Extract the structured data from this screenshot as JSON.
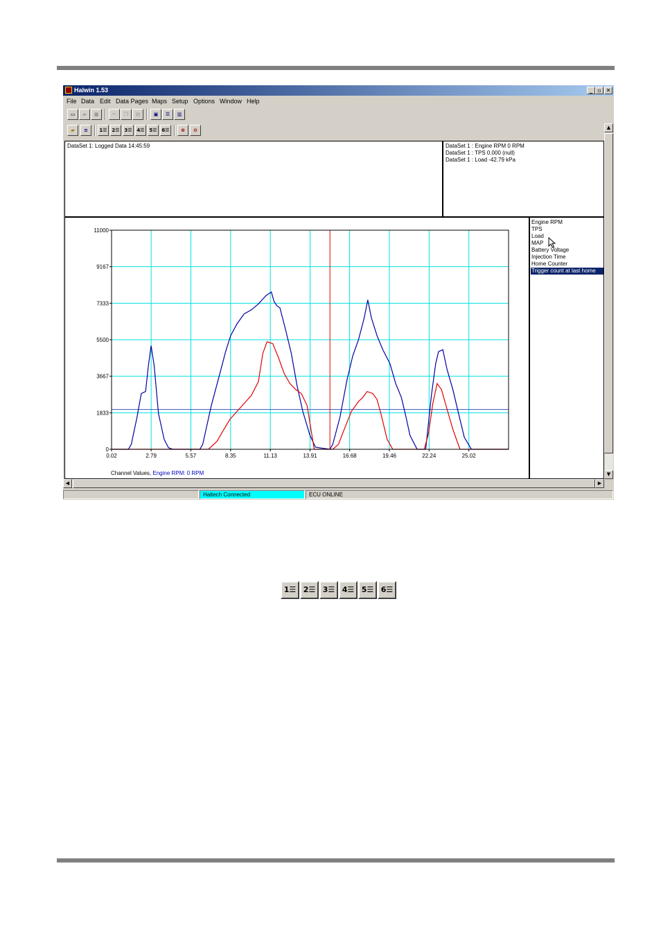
{
  "window": {
    "title": "Halwin 1.53",
    "controls": {
      "minimize": "_",
      "restore": "▫",
      "close": "✕"
    }
  },
  "menu": [
    "File",
    "Data",
    "Edit",
    "Data Pages",
    "Maps",
    "Setup",
    "Options",
    "Window",
    "Help"
  ],
  "info_left": {
    "line1": "DataSet 1: Logged Data 14:45:59"
  },
  "info_right": {
    "lines": [
      "DataSet 1 : Engine RPM 0 RPM",
      "DataSet 1 : TPS 0.000 (null)",
      "DataSet 1 : Load -42.79 kPa"
    ]
  },
  "channels": [
    "Engine RPM",
    "TPS",
    "Load",
    "MAP",
    "Battery Voltage",
    "Injection Time",
    "Home Counter",
    "Trigger count at last home"
  ],
  "selected_channel": 7,
  "channel_values": {
    "label": "Channel Values,",
    "value": "Engine RPM: 0 RPM"
  },
  "status": {
    "panel1": "",
    "panel2": "Haltech Connected",
    "panel3": "ECU ONLINE"
  },
  "toolbar2_numbers": [
    "1",
    "2",
    "3",
    "4",
    "5",
    "6"
  ],
  "zoom_buttons": [
    "1",
    "2",
    "3",
    "4",
    "5",
    "6"
  ],
  "colors": {
    "grid": "#00e0e0",
    "series_blue": "#0000a0",
    "series_red": "#e00000",
    "cursor": "#e00000",
    "connected_bg": "#00ffff"
  },
  "chart_data": {
    "type": "line",
    "xlim": [
      0.02,
      27.8
    ],
    "ylim": [
      0,
      11000
    ],
    "xticks": [
      "0.02",
      "2.79",
      "5.57",
      "8.35",
      "11.13",
      "13.91",
      "16.68",
      "19.46",
      "22.24",
      "25.02"
    ],
    "yticks": [
      "0",
      "1833",
      "3667",
      "5500",
      "7333",
      "9167",
      "11000"
    ],
    "cursor_x": 15.3,
    "hline_y": 2000,
    "series": [
      {
        "color": "#0000a0",
        "x": [
          0.02,
          1.2,
          1.4,
          1.8,
          2.1,
          2.4,
          2.6,
          2.79,
          3.0,
          3.3,
          3.7,
          4.0,
          4.3,
          4.5,
          6.2,
          6.4,
          7.0,
          7.6,
          8.0,
          8.35,
          8.8,
          9.3,
          9.8,
          10.3,
          10.8,
          11.2,
          11.4,
          11.6,
          11.8,
          12.2,
          12.6,
          13.0,
          13.4,
          13.9,
          14.3,
          15.3,
          15.5,
          16.0,
          16.5,
          16.9,
          17.3,
          17.7,
          17.95,
          18.2,
          18.6,
          19.0,
          19.5,
          19.9,
          20.3,
          20.6,
          20.9,
          21.4,
          21.7,
          22.0,
          22.4,
          22.7,
          22.9,
          23.2,
          23.5,
          23.9,
          24.3,
          24.7,
          25.2,
          27.8
        ],
        "y": [
          0,
          0,
          250,
          1600,
          2800,
          2900,
          4200,
          5200,
          4200,
          1800,
          500,
          80,
          0,
          0,
          0,
          250,
          2200,
          3800,
          4900,
          5700,
          6300,
          6800,
          7000,
          7300,
          7700,
          7900,
          7400,
          7200,
          7100,
          6000,
          4800,
          3200,
          1900,
          700,
          100,
          0,
          250,
          1600,
          3500,
          4700,
          5500,
          6600,
          7500,
          6600,
          5700,
          5000,
          4300,
          3300,
          2600,
          1700,
          700,
          0,
          0,
          0,
          2700,
          4300,
          4900,
          5000,
          4000,
          3000,
          1800,
          600,
          0,
          0
        ]
      },
      {
        "color": "#e00000",
        "x": [
          0.02,
          6.8,
          7.4,
          7.8,
          8.3,
          8.8,
          9.3,
          9.8,
          10.3,
          10.6,
          10.9,
          11.3,
          11.7,
          12.1,
          12.5,
          12.9,
          13.3,
          13.7,
          14.2,
          15.5,
          15.9,
          16.3,
          16.8,
          17.3,
          17.6,
          17.9,
          18.3,
          18.6,
          18.9,
          19.3,
          19.7,
          20.1,
          21.9,
          22.2,
          22.5,
          22.8,
          23.1,
          23.5,
          23.9,
          24.4,
          24.7,
          27.8
        ],
        "y": [
          0,
          0,
          400,
          900,
          1500,
          1900,
          2300,
          2700,
          3400,
          4800,
          5400,
          5300,
          4600,
          3800,
          3300,
          3000,
          2800,
          2200,
          0,
          0,
          250,
          1000,
          1900,
          2400,
          2600,
          2900,
          2800,
          2500,
          1700,
          500,
          0,
          0,
          0,
          800,
          2300,
          3300,
          3000,
          2000,
          1000,
          0,
          0,
          0
        ]
      }
    ]
  }
}
